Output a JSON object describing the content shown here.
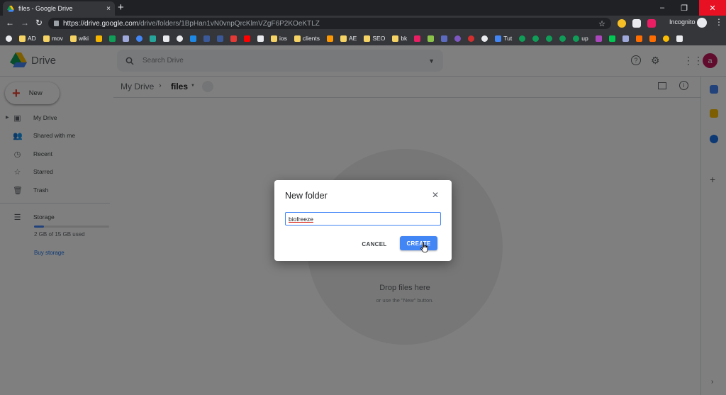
{
  "browser": {
    "tab_title": "files - Google Drive",
    "tab_close": "×",
    "new_tab": "+",
    "url_host": "https://drive.google.com",
    "url_path": "/drive/folders/1BpHan1vN0vnpQrcKlmVZgF6P2KOeKTLZ",
    "mode_label": "Incognito",
    "bookmarks": [
      "AD",
      "mov",
      "wiki",
      "",
      "",
      "",
      "",
      "",
      "",
      "",
      "",
      "",
      "",
      "",
      "ios",
      "clients",
      "AE",
      "SEO",
      "bk",
      "",
      "",
      "",
      "",
      "",
      "Tut",
      "",
      "",
      "",
      "up"
    ],
    "window_controls": [
      "–",
      "❐",
      "✕"
    ]
  },
  "drive": {
    "brand": "Drive",
    "search_placeholder": "Search Drive",
    "avatar_letter": "a"
  },
  "sidebar": {
    "new_label": "New",
    "items": [
      {
        "label": "My Drive",
        "icon": "my-drive-icon"
      },
      {
        "label": "Shared with me",
        "icon": "shared-icon"
      },
      {
        "label": "Recent",
        "icon": "clock-icon"
      },
      {
        "label": "Starred",
        "icon": "star-icon"
      },
      {
        "label": "Trash",
        "icon": "trash-icon"
      }
    ],
    "storage_label": "Storage",
    "storage_used": "2 GB of 15 GB used",
    "buy_storage": "Buy storage"
  },
  "breadcrumb": {
    "root": "My Drive",
    "current": "files"
  },
  "empty_state": {
    "title": "Drop files here",
    "subtitle": "or use the \"New\" button."
  },
  "dialog": {
    "title": "New folder",
    "input_value": "biofreeze",
    "cancel_label": "CANCEL",
    "create_label": "CREATE"
  },
  "colors": {
    "accent": "#4285f4",
    "avatar": "#c2185b",
    "close_button": "#e81123"
  }
}
